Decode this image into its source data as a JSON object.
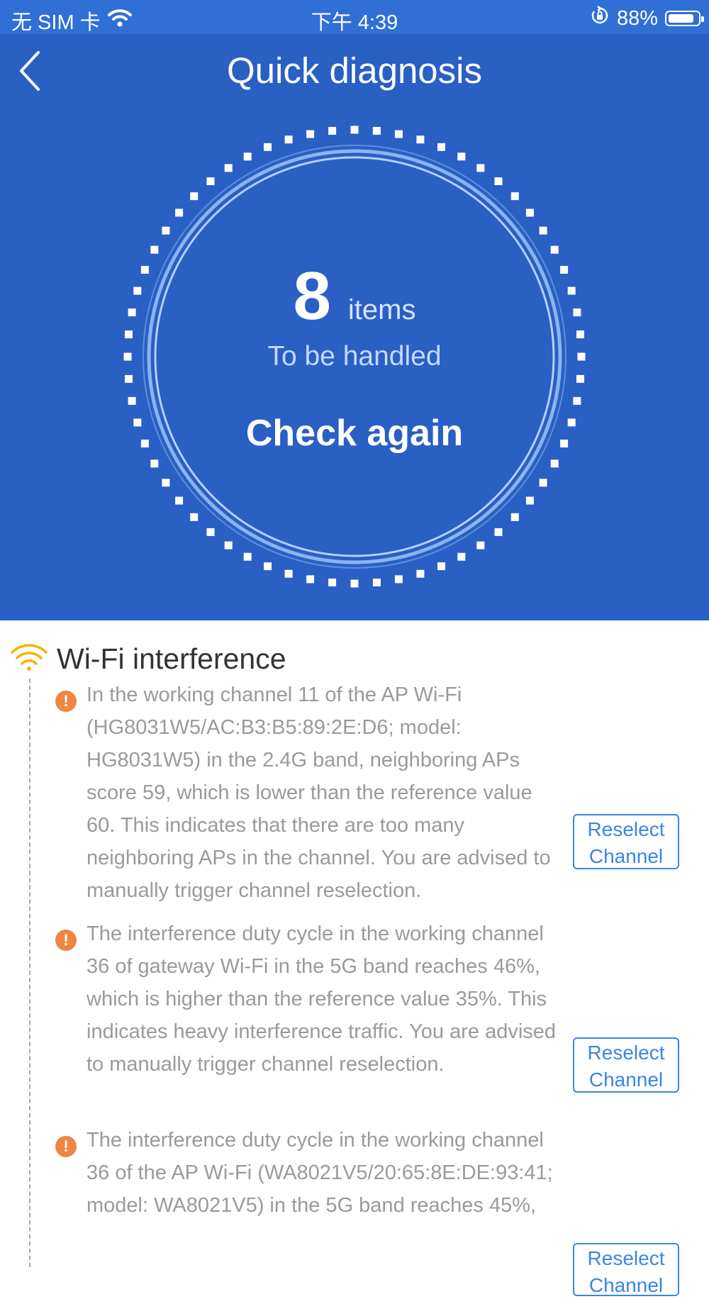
{
  "status_bar": {
    "carrier": "无 SIM 卡",
    "time": "下午 4:39",
    "battery_percent": "88%",
    "battery_level": 0.88
  },
  "header": {
    "title": "Quick diagnosis",
    "back_icon": "chevron-left-icon",
    "count": "8",
    "count_unit": "items",
    "subtitle": "To be handled",
    "check_again": "Check again"
  },
  "colors": {
    "header_bg": "#2a5fc4",
    "status_bg": "#2f6fd6",
    "warning": "#ee8642",
    "button_blue": "#3a86e0",
    "wifi_icon": "#f3b400"
  },
  "section": {
    "icon": "wifi-icon",
    "title": "Wi-Fi interference",
    "issues": [
      {
        "text": "In the working channel 11 of the AP Wi-Fi (HG8031W5/AC:B3:B5:89:2E:D6; model: HG8031W5) in the 2.4G band, neighboring APs score 59, which is lower than the reference value 60. This indicates that there are too many neighboring APs in the channel. You are advised to manually trigger channel reselection.",
        "button": "Reselect\nChannel"
      },
      {
        "text": "The interference duty cycle in the working channel 36 of gateway Wi-Fi in the 5G band reaches 46%, which is higher than the reference value 35%. This indicates heavy interference traffic. You are advised to manually trigger channel reselection.",
        "button": "Reselect\nChannel"
      },
      {
        "text": "The interference duty cycle in the working channel 36 of the AP Wi-Fi (WA8021V5/20:65:8E:DE:93:41; model: WA8021V5) in the 5G band reaches 45%,",
        "button": "Reselect\nChannel"
      }
    ]
  }
}
